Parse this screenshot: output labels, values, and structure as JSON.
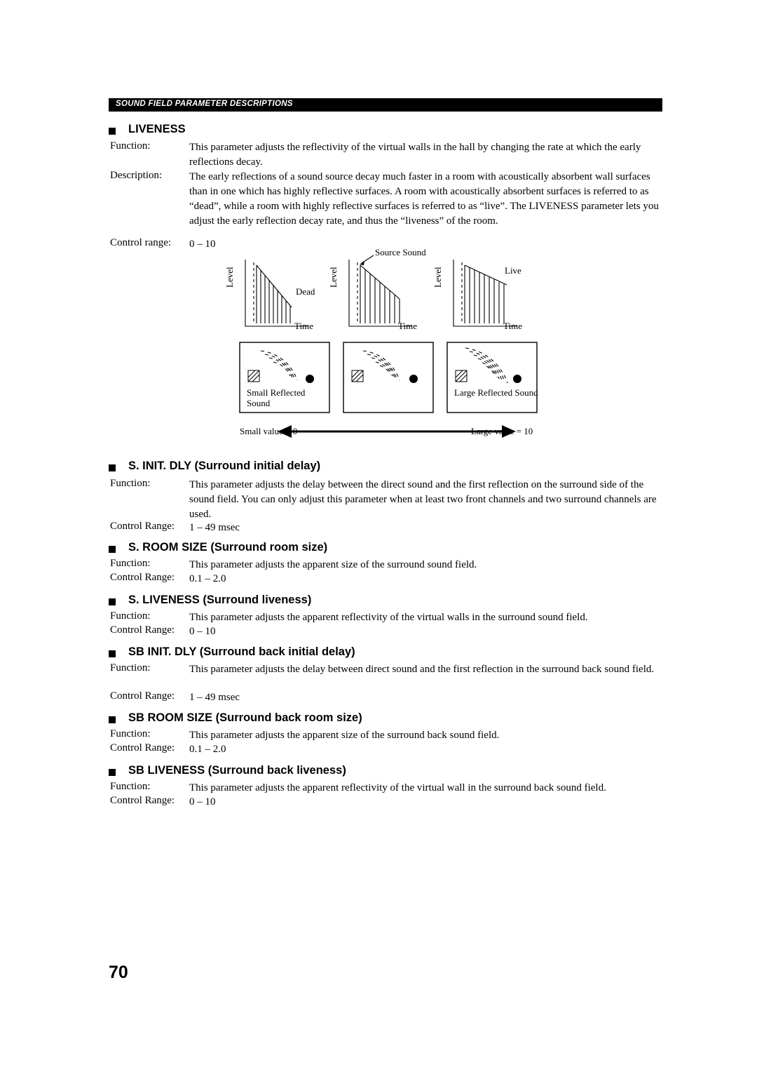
{
  "header": {
    "title": "SOUND FIELD PARAMETER DESCRIPTIONS"
  },
  "page_number": "70",
  "sections": [
    {
      "heading": "LIVENESS",
      "rows": [
        {
          "label": "Function:",
          "text": "This parameter adjusts the reflectivity of the virtual walls in the hall by changing the rate at which the early reflections decay."
        },
        {
          "label": "Description:",
          "text": "The early reflections of a sound source decay much faster in a room with acoustically absorbent wall surfaces than in one which has highly reflective surfaces. A room with acoustically absorbent surfaces is referred to as “dead”, while a room with highly reflective surfaces is referred to as “live”. The LIVENESS parameter lets you adjust the early reflection decay rate, and thus the “liveness” of the room."
        },
        {
          "label": "Control range:",
          "text": "0 – 10"
        }
      ]
    },
    {
      "heading": "S. INIT. DLY (Surround initial delay)",
      "rows": [
        {
          "label": "Function:",
          "text": "This parameter adjusts the delay between the direct sound and the first reflection on the surround side of the sound field. You can only adjust this parameter when at least two front channels and two surround channels are used."
        },
        {
          "label": "Control Range:",
          "text": "1 – 49 msec"
        }
      ]
    },
    {
      "heading": "S. ROOM SIZE (Surround room size)",
      "rows": [
        {
          "label": "Function:",
          "text": "This parameter adjusts the apparent size of the surround sound field."
        },
        {
          "label": "Control Range:",
          "text": "0.1 – 2.0"
        }
      ]
    },
    {
      "heading": "S. LIVENESS (Surround liveness)",
      "rows": [
        {
          "label": "Function:",
          "text": "This parameter adjusts the apparent reflectivity of the virtual walls in the surround sound field."
        },
        {
          "label": "Control Range:",
          "text": "0 – 10"
        }
      ]
    },
    {
      "heading": "SB INIT. DLY (Surround back initial delay)",
      "rows": [
        {
          "label": "Function:",
          "text": "This parameter adjusts the delay between direct sound and the first reflection in the surround back sound field."
        },
        {
          "label": "Control Range:",
          "text": "1 – 49 msec"
        }
      ]
    },
    {
      "heading": "SB ROOM SIZE (Surround back room size)",
      "rows": [
        {
          "label": "Function:",
          "text": "This parameter adjusts the apparent size of the surround back sound field."
        },
        {
          "label": "Control Range:",
          "text": "0.1 – 2.0"
        }
      ]
    },
    {
      "heading": "SB LIVENESS (Surround back liveness)",
      "rows": [
        {
          "label": "Function:",
          "text": "This parameter adjusts the apparent reflectivity of the virtual wall in the surround back sound field."
        },
        {
          "label": "Control Range:",
          "text": "0 – 10"
        }
      ]
    }
  ],
  "figure": {
    "graph_left": {
      "axis_y": "Level",
      "axis_x": "Time",
      "label": "Dead"
    },
    "graph_mid": {
      "axis_y": "Level",
      "axis_x": "Time",
      "label": "Source Sound"
    },
    "graph_right": {
      "axis_y": "Level",
      "axis_x": "Time",
      "label": "Live"
    },
    "room_left": {
      "caption": "Small Reflected Sound"
    },
    "room_mid": {
      "caption": ""
    },
    "room_right": {
      "caption": "Large Reflected Sound"
    },
    "scale_left": "Small value = 0",
    "scale_right": "Large value = 10"
  }
}
